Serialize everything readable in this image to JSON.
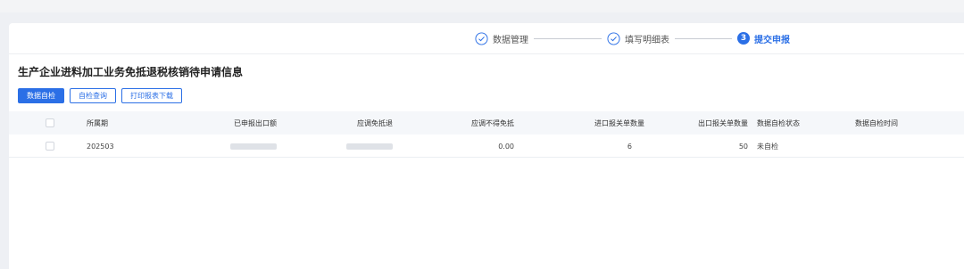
{
  "stepper": {
    "steps": [
      {
        "label": "数据管理",
        "state": "done"
      },
      {
        "label": "填写明细表",
        "state": "done"
      },
      {
        "label": "提交申报",
        "state": "active",
        "number": "3"
      }
    ]
  },
  "page": {
    "title": "生产企业进料加工业务免抵退税核销待申请信息"
  },
  "toolbar": {
    "self_check": "数据自检",
    "check_query": "自检查询",
    "print_download": "打印报表下载"
  },
  "table": {
    "columns": {
      "period": "所属期",
      "declared_export": "已申报出口额",
      "adjust_exempt_refund": "应调免抵退",
      "adjust_not_exempt": "应调不得免抵",
      "import_decl_count": "进口报关单数量",
      "export_decl_count": "出口报关单数量",
      "check_status": "数据自检状态",
      "check_time": "数据自检时间"
    },
    "rows": [
      {
        "period": "202503",
        "adjust_not_exempt": "0.00",
        "import_decl_count": "6",
        "export_decl_count": "50",
        "check_status": "未自检",
        "check_time": ""
      }
    ]
  },
  "colors": {
    "primary": "#2b6fe6",
    "header_bg": "#f5f7fa"
  }
}
